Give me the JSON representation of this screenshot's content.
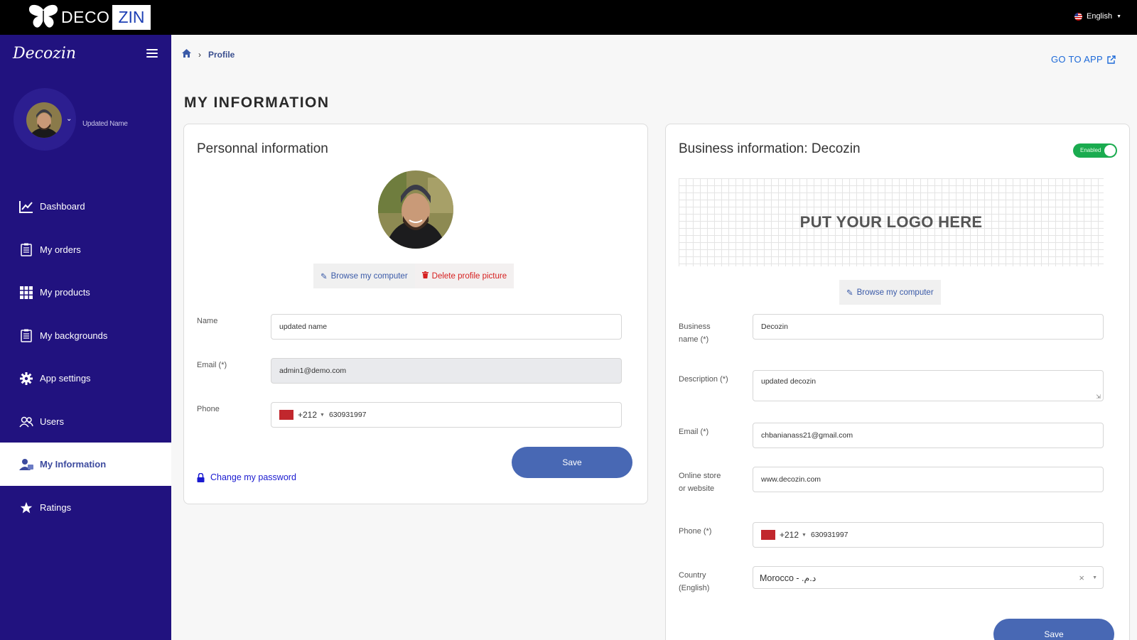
{
  "topbar": {
    "logo_left": "DECO",
    "logo_right": "ZIN",
    "language": "English"
  },
  "sidebar": {
    "brand": "Decozin",
    "profile_name": "Updated Name",
    "items": [
      {
        "label": "Dashboard",
        "icon": "chart-line-icon"
      },
      {
        "label": "My orders",
        "icon": "clipboard-icon"
      },
      {
        "label": "My products",
        "icon": "grid-icon"
      },
      {
        "label": "My backgrounds",
        "icon": "clipboard-icon"
      },
      {
        "label": "App settings",
        "icon": "gear-icon"
      },
      {
        "label": "Users",
        "icon": "users-icon"
      },
      {
        "label": "My Information",
        "icon": "user-info-icon",
        "active": true
      },
      {
        "label": "Ratings",
        "icon": "star-icon"
      }
    ]
  },
  "breadcrumb": {
    "current": "Profile"
  },
  "header": {
    "go_to_app": "GO TO APP",
    "page_title": "MY INFORMATION"
  },
  "personal": {
    "title": "Personnal information",
    "browse_label": "Browse my computer",
    "delete_label": "Delete profile picture",
    "name_label": "Name",
    "name_value": "updated name",
    "email_label": "Email (*)",
    "email_value": "admin1@demo.com",
    "phone_label": "Phone",
    "phone_code": "+212",
    "phone_value": "630931997",
    "save_label": "Save",
    "change_password": "Change my password"
  },
  "business": {
    "title": "Business information: Decozin",
    "toggle_label": "Enabled",
    "logo_placeholder": "PUT YOUR LOGO HERE",
    "browse_label": "Browse my computer",
    "business_name_label_1": "Business",
    "business_name_label_2": "name (*)",
    "business_name_value": "Decozin",
    "description_label": "Description (*)",
    "description_value": "updated decozin",
    "email_label": "Email (*)",
    "email_value": "chbanianass21@gmail.com",
    "website_label_1": "Online store",
    "website_label_2": "or website",
    "website_value": "www.decozin.com",
    "phone_label": "Phone (*)",
    "phone_code": "+212",
    "phone_value": "630931997",
    "country_label_1": "Country",
    "country_label_2": "(English)",
    "country_value": "Morocco - .د.م",
    "save_label": "Save"
  },
  "colors": {
    "sidebar_bg": "#21127f",
    "accent_button": "#4868b4",
    "toggle_on": "#1aab4f",
    "link_blue": "#1e6ad8",
    "delete_red": "#d62020"
  }
}
